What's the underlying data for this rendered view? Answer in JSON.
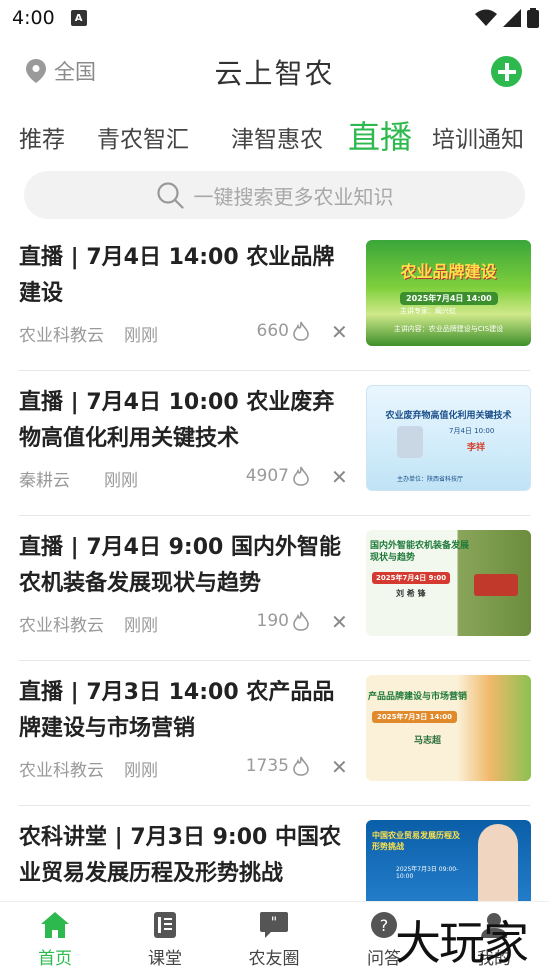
{
  "status": {
    "time": "4:00"
  },
  "header": {
    "location": "全国",
    "app_title": "云上智农"
  },
  "tabs": [
    {
      "label": "推荐"
    },
    {
      "label": "青农智汇"
    },
    {
      "label": "津智惠农"
    },
    {
      "label": "直播"
    },
    {
      "label": "培训通知"
    }
  ],
  "search": {
    "placeholder": "一键搜索更多农业知识"
  },
  "items": [
    {
      "title": "直播 | 7月4日 14:00 农业品牌建设",
      "source": "农业科教云",
      "time": "刚刚",
      "views": "660",
      "thumb": {
        "headline": "农业品牌建设",
        "date": "2025年7月4日 14:00",
        "sub": "主讲专家：阚兴虹",
        "foot": "主讲内容：农业品牌建设与CIS建设"
      }
    },
    {
      "title": "直播 | 7月4日 10:00 农业废弃物高值化利用关键技术",
      "source": "秦耕云",
      "time": "刚刚",
      "views": "4907",
      "thumb": {
        "headline": "农业废弃物高值化利用关键技术",
        "date": "7月4日 10:00",
        "sub": "李祥",
        "foot": "主办单位：陕西省科技厅"
      }
    },
    {
      "title": "直播 | 7月4日 9:00 国内外智能农机装备发展现状与趋势",
      "source": "农业科教云",
      "time": "刚刚",
      "views": "190",
      "thumb": {
        "headline": "国内外智能农机装备发展现状与趋势",
        "date": "2025年7月4日 9:00",
        "sub": "刘 希 锋",
        "foot": ""
      }
    },
    {
      "title": "直播 | 7月3日 14:00 农产品品牌建设与市场营销",
      "source": "农业科教云",
      "time": "刚刚",
      "views": "1735",
      "thumb": {
        "headline": "产品品牌建设与市场营销",
        "date": "2025年7月3日 14:00",
        "sub": "马志超",
        "foot": ""
      }
    },
    {
      "title": "农科讲堂 | 7月3日 9:00 中国农业贸易发展历程及形势挑战",
      "source": "",
      "time": "",
      "views": "",
      "thumb": {
        "headline": "中国农业贸易发展历程及形势挑战",
        "date": "2025年7月3日 09:00-10:00",
        "sub": "",
        "foot": ""
      }
    }
  ],
  "bottom_nav": [
    {
      "label": "首页"
    },
    {
      "label": "课堂"
    },
    {
      "label": "农友圈"
    },
    {
      "label": "问答"
    },
    {
      "label": "我的"
    }
  ],
  "watermark": "大玩家",
  "colors": {
    "accent": "#2db94d"
  }
}
